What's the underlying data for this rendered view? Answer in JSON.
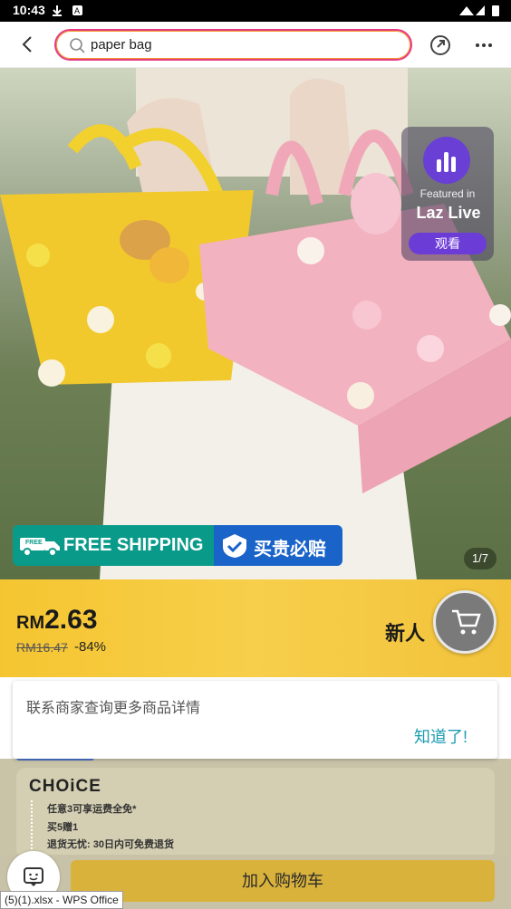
{
  "status": {
    "time": "10:43"
  },
  "search": {
    "value": "paper bag"
  },
  "hero": {
    "lazlive_label": "Featured in",
    "lazlive_brand": "Laz Live",
    "lazlive_button": "观看",
    "free_shipping": "FREE SHIPPING",
    "free_badge": "FREE",
    "guarantee": "买贵必赔",
    "counter": "1/7"
  },
  "price": {
    "currency": "RM",
    "value": "2.63",
    "original": "RM16.47",
    "discount": "-84%",
    "new_user": "新人"
  },
  "tooltip": {
    "message": "联系商家查询更多商品详情",
    "ok": "知道了!"
  },
  "choice": {
    "logo": "CHOiCE",
    "items": [
      "任意3可享运费全免*",
      "买5赠1",
      "退货无忧: 30日内可免费退货"
    ]
  },
  "bottom": {
    "add_to_cart": "加入购物车"
  },
  "taskbar": {
    "label": "(5)(1).xlsx - WPS Office"
  }
}
